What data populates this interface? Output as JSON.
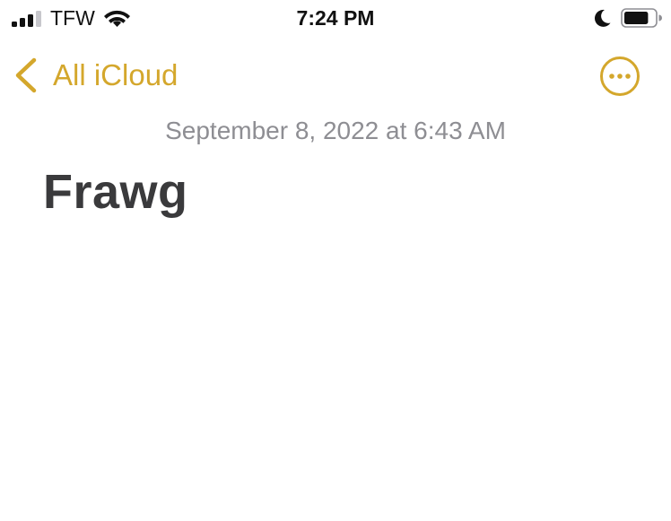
{
  "status_bar": {
    "carrier": "TFW",
    "time": "7:24 PM",
    "signal_bars_active": 3,
    "battery_level": 0.8,
    "icons": [
      "signal-icon",
      "wifi-icon",
      "moon-icon",
      "battery-icon"
    ]
  },
  "nav": {
    "back_label": "All iCloud",
    "back_icon": "chevron-left-icon",
    "more_icon": "ellipsis-circle-icon"
  },
  "note": {
    "date": "September 8, 2022 at 6:43 AM",
    "title": "Frawg"
  },
  "colors": {
    "accent": "#d4a72c",
    "date_text": "#8e8e93",
    "title_text": "#3a3a3c",
    "background": "#ffffff"
  }
}
